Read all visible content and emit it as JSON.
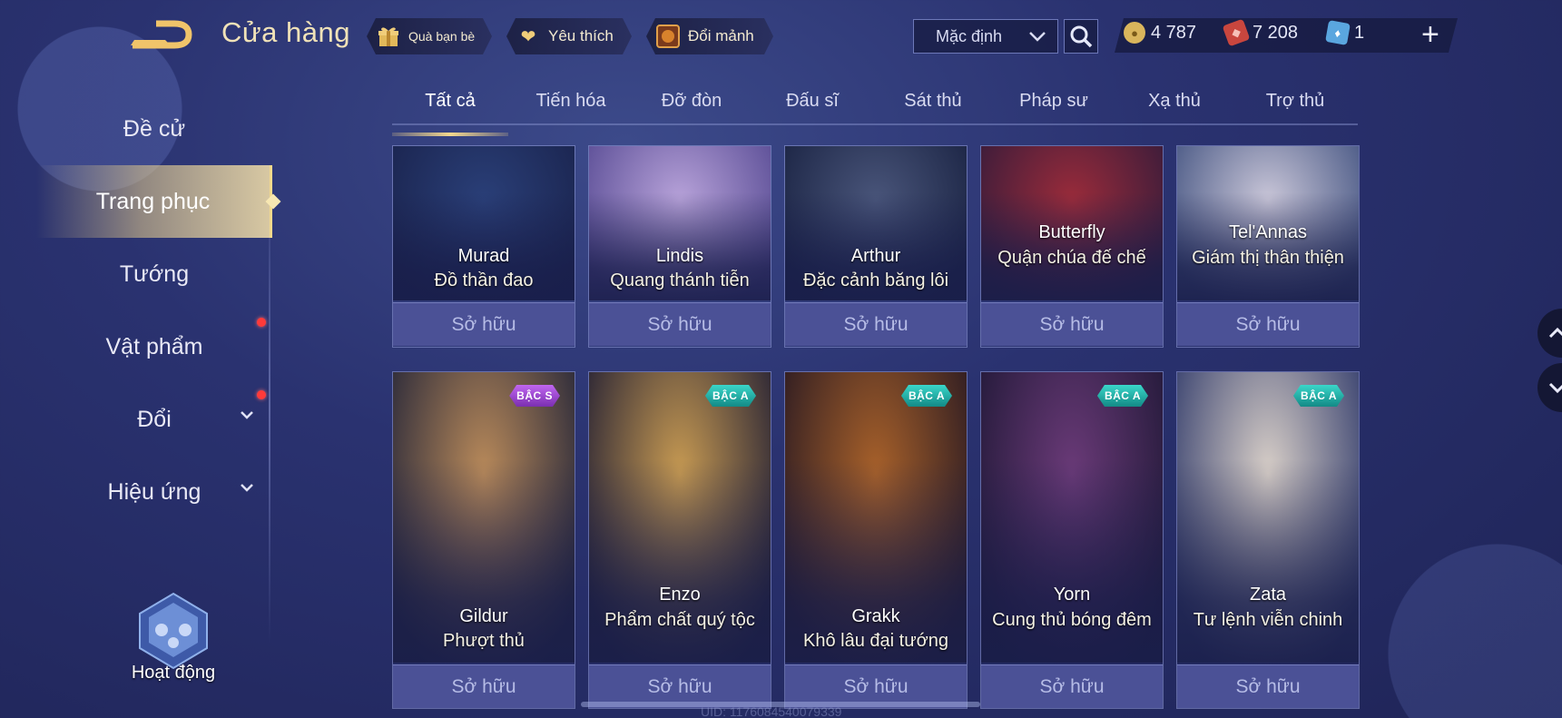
{
  "header": {
    "title": "Cửa hàng",
    "chips": [
      {
        "label": "Quà bạn bè",
        "icon": "gift-icon"
      },
      {
        "label": "Yêu thích",
        "icon": "heart-icon"
      },
      {
        "label": "Đổi mảnh",
        "icon": "shard-exchange-icon"
      }
    ],
    "sort_label": "Mặc định",
    "currencies": [
      {
        "icon": "gold-coin-icon",
        "value": "4 787",
        "color": "#e5c36a"
      },
      {
        "icon": "voucher-icon",
        "value": "7 208",
        "color": "#d6504a"
      },
      {
        "icon": "ticket-icon",
        "value": "1",
        "color": "#6fb5e8"
      }
    ]
  },
  "sidebar": {
    "items": [
      {
        "label": "Đề cử",
        "active": false
      },
      {
        "label": "Trang phục",
        "active": true
      },
      {
        "label": "Tướng",
        "active": false
      },
      {
        "label": "Vật phẩm",
        "active": false,
        "notification": true
      },
      {
        "label": "Đổi",
        "active": false,
        "notification": true,
        "expandable": true
      },
      {
        "label": "Hiệu ứng",
        "active": false,
        "expandable": true
      }
    ],
    "event_label": "Hoạt động"
  },
  "tabs": [
    {
      "label": "Tất cả",
      "active": true
    },
    {
      "label": "Tiến hóa"
    },
    {
      "label": "Đỡ đòn"
    },
    {
      "label": "Đấu sĩ"
    },
    {
      "label": "Sát thủ"
    },
    {
      "label": "Pháp sư"
    },
    {
      "label": "Xạ thủ"
    },
    {
      "label": "Trợ thủ"
    }
  ],
  "row1": [
    {
      "hero": "Murad",
      "skin": "Đồ thần đao",
      "status": "Sở hữu",
      "palette": [
        "#2a3f78",
        "#1b2550"
      ]
    },
    {
      "hero": "Lindis",
      "skin": "Quang thánh tiễn",
      "status": "Sở hữu",
      "palette": [
        "#b7a2d9",
        "#5c4f97"
      ]
    },
    {
      "hero": "Arthur",
      "skin": "Đặc cảnh băng lôi",
      "status": "Sở hữu",
      "palette": [
        "#49557a",
        "#1c2545"
      ]
    },
    {
      "hero": "Butterfly",
      "skin": "Quận chúa đế chế",
      "status": "Sở hữu",
      "palette": [
        "#9a2b3a",
        "#3b1c3a"
      ]
    },
    {
      "hero": "Tel'Annas",
      "skin": "Giám thị thân thiện",
      "status": "Sở hữu",
      "palette": [
        "#c9c6d8",
        "#4b5a86"
      ]
    }
  ],
  "row2": [
    {
      "hero": "Gildur",
      "skin": "Phượt thủ",
      "status": "Sở hữu",
      "tier": "BẬC S",
      "tier_class": "s",
      "palette": [
        "#b98a5a",
        "#2b2a3a"
      ]
    },
    {
      "hero": "Enzo",
      "skin": "Phẩm chất quý tộc",
      "status": "Sở hữu",
      "tier": "BẬC A",
      "tier_class": "a",
      "palette": [
        "#c79a52",
        "#2a2535"
      ]
    },
    {
      "hero": "Grakk",
      "skin": "Khô lâu đại tướng",
      "status": "Sở hữu",
      "tier": "BẬC A",
      "tier_class": "a",
      "palette": [
        "#a8612a",
        "#2e1c22"
      ]
    },
    {
      "hero": "Yorn",
      "skin": "Cung thủ bóng đêm",
      "status": "Sở hữu",
      "tier": "BẬC A",
      "tier_class": "a",
      "palette": [
        "#6a3a78",
        "#241a3a"
      ]
    },
    {
      "hero": "Zata",
      "skin": "Tư lệnh viễn chinh",
      "status": "Sở hữu",
      "tier": "BẬC A",
      "tier_class": "a",
      "palette": [
        "#d8cfc8",
        "#3a4370"
      ]
    }
  ],
  "footer": {
    "uid": "UID: 1176084540079339"
  }
}
